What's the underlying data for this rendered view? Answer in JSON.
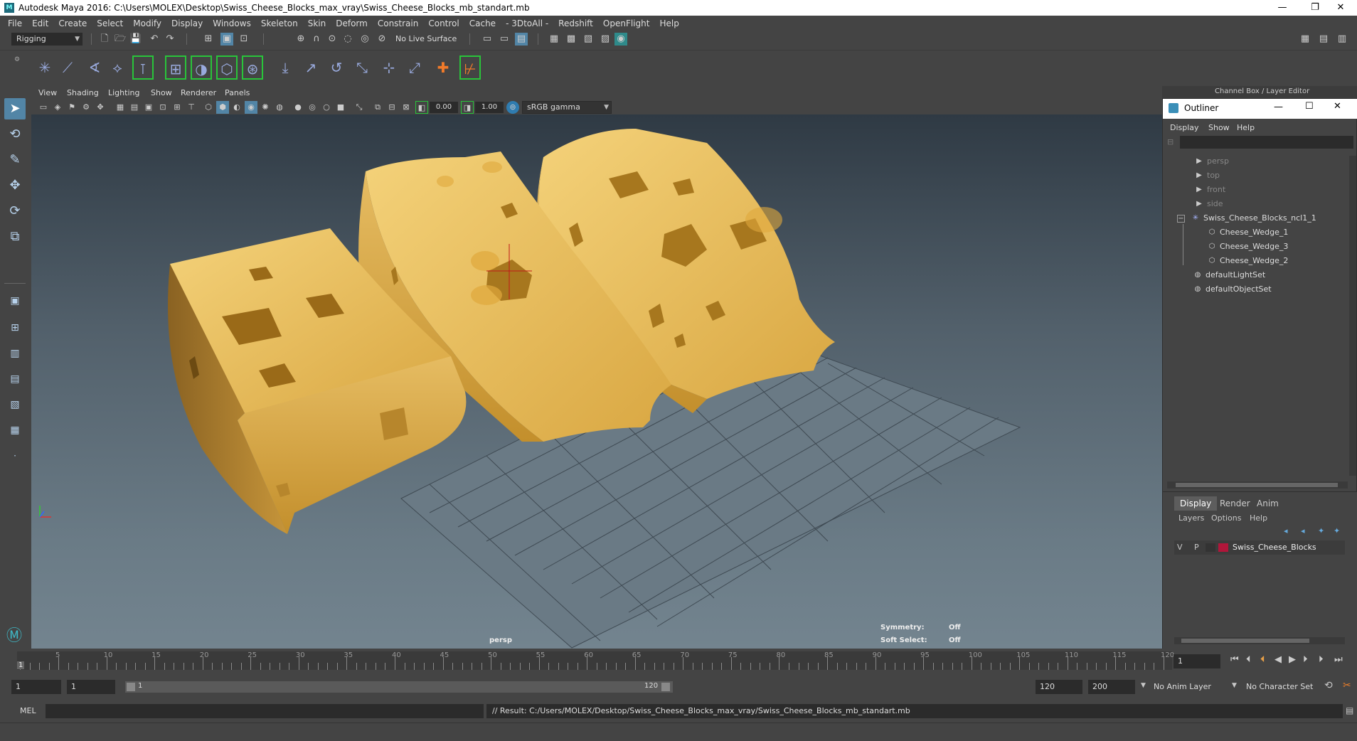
{
  "window": {
    "title": "Autodesk Maya 2016: C:\\Users\\MOLEX\\Desktop\\Swiss_Cheese_Blocks_max_vray\\Swiss_Cheese_Blocks_mb_standart.mb",
    "minimize": "—",
    "restore": "❐",
    "close": "✕"
  },
  "menubar": [
    "File",
    "Edit",
    "Create",
    "Select",
    "Modify",
    "Display",
    "Windows",
    "Skeleton",
    "Skin",
    "Deform",
    "Constrain",
    "Control",
    "Cache",
    "- 3DtoAll -",
    "Redshift",
    "OpenFlight",
    "Help"
  ],
  "statusline": {
    "mode": "Rigging",
    "live_surface": "No Live Surface"
  },
  "panel": {
    "menu": [
      "View",
      "Shading",
      "Lighting",
      "Show",
      "Renderer",
      "Panels"
    ],
    "exposure": "0.00",
    "gamma": "1.00",
    "color_space": "sRGB gamma",
    "camera_label": "persp",
    "symmetry_label": "Symmetry:",
    "symmetry_value": "Off",
    "soft_select_label": "Soft Select:",
    "soft_select_value": "Off"
  },
  "channel_box": {
    "title": "Channel Box / Layer Editor"
  },
  "outliner": {
    "title": "Outliner",
    "menu": [
      "Display",
      "Show",
      "Help"
    ],
    "items": [
      {
        "label": "persp",
        "indent": 0,
        "icon": "camera-icon",
        "dim": true
      },
      {
        "label": "top",
        "indent": 0,
        "icon": "camera-icon",
        "dim": true
      },
      {
        "label": "front",
        "indent": 0,
        "icon": "camera-icon",
        "dim": true
      },
      {
        "label": "side",
        "indent": 0,
        "icon": "camera-icon",
        "dim": true
      },
      {
        "label": "Swiss_Cheese_Blocks_ncl1_1",
        "indent": 0,
        "icon": "group-icon",
        "dim": false,
        "expand": "−"
      },
      {
        "label": "Cheese_Wedge_1",
        "indent": 1,
        "icon": "mesh-icon",
        "dim": false
      },
      {
        "label": "Cheese_Wedge_3",
        "indent": 1,
        "icon": "mesh-icon",
        "dim": false
      },
      {
        "label": "Cheese_Wedge_2",
        "indent": 1,
        "icon": "mesh-icon",
        "dim": false
      },
      {
        "label": "defaultLightSet",
        "indent": 0,
        "icon": "set-icon",
        "dim": false
      },
      {
        "label": "defaultObjectSet",
        "indent": 0,
        "icon": "set-icon",
        "dim": false
      }
    ]
  },
  "layer_editor": {
    "tabs": [
      "Display",
      "Render",
      "Anim"
    ],
    "menu": [
      "Layers",
      "Options",
      "Help"
    ],
    "layer": {
      "v": "V",
      "p": "P",
      "name": "Swiss_Cheese_Blocks",
      "color": "#b0163a"
    }
  },
  "timeline": {
    "ticks": [
      5,
      10,
      15,
      20,
      25,
      30,
      35,
      40,
      45,
      50,
      55,
      60,
      65,
      70,
      75,
      80,
      85,
      90,
      95,
      100,
      105,
      110,
      115,
      120
    ],
    "current_marker": "1",
    "current_frame": "1"
  },
  "range": {
    "start": "1",
    "playback_start": "1",
    "slider_start": "1",
    "slider_end": "120",
    "playback_end": "120",
    "end": "200",
    "anim_layer": "No Anim Layer",
    "char_set": "No Character Set"
  },
  "command": {
    "lang": "MEL",
    "result": "// Result: C:/Users/MOLEX/Desktop/Swiss_Cheese_Blocks_max_vray/Swiss_Cheese_Blocks_mb_standart.mb"
  }
}
